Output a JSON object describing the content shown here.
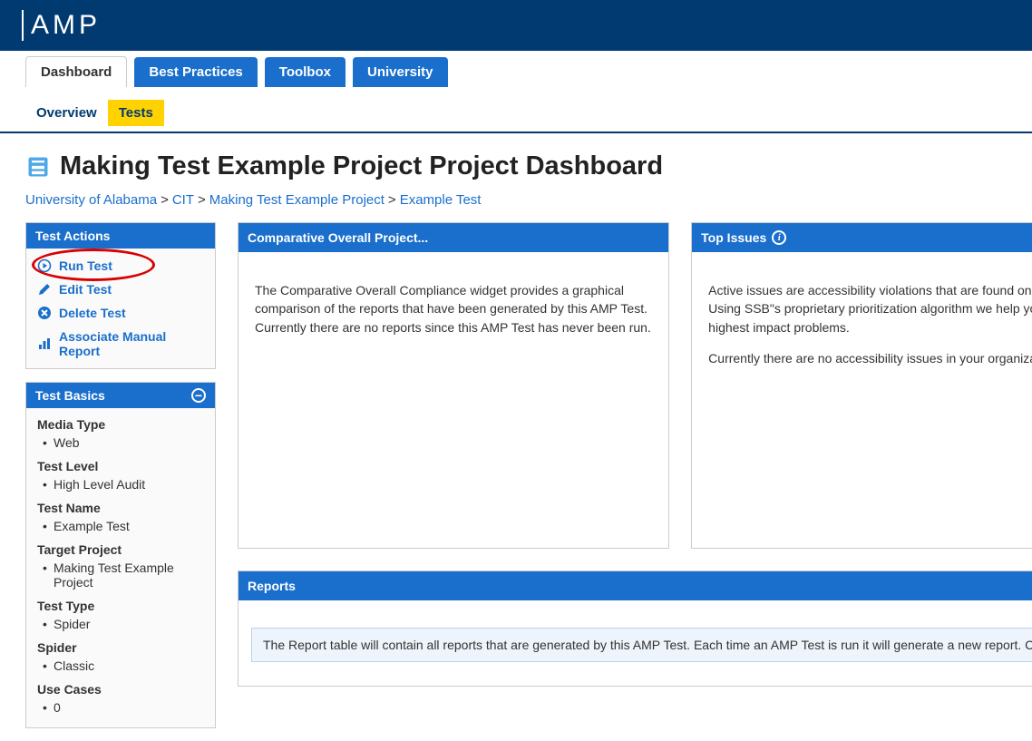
{
  "app_name": "AMP",
  "tabs": [
    {
      "label": "Dashboard",
      "active": true
    },
    {
      "label": "Best Practices",
      "active": false
    },
    {
      "label": "Toolbox",
      "active": false
    },
    {
      "label": "University",
      "active": false
    }
  ],
  "subtabs": [
    {
      "label": "Overview",
      "active": false
    },
    {
      "label": "Tests",
      "active": true
    }
  ],
  "page_title": "Making Test Example Project Project Dashboard",
  "breadcrumb": [
    "University of Alabama",
    "CIT",
    "Making Test Example Project",
    "Example Test"
  ],
  "test_actions": {
    "title": "Test Actions",
    "items": [
      {
        "label": "Run Test",
        "icon": "play-icon",
        "highlight": true
      },
      {
        "label": "Edit Test",
        "icon": "pencil-icon"
      },
      {
        "label": "Delete Test",
        "icon": "delete-icon"
      },
      {
        "label": "Associate Manual Report",
        "icon": "chart-icon"
      }
    ]
  },
  "test_basics": {
    "title": "Test Basics",
    "fields": [
      {
        "label": "Media Type",
        "value": "Web"
      },
      {
        "label": "Test Level",
        "value": "High Level Audit"
      },
      {
        "label": "Test Name",
        "value": "Example Test"
      },
      {
        "label": "Target Project",
        "value": "Making Test Example Project"
      },
      {
        "label": "Test Type",
        "value": "Spider"
      },
      {
        "label": "Spider",
        "value": "Classic"
      },
      {
        "label": "Use Cases",
        "value": "0"
      }
    ]
  },
  "widgets": {
    "comparative": {
      "title": "Comparative Overall Project...",
      "body": "The Comparative Overall Compliance widget provides a graphical comparison of the reports that have been generated by this AMP Test. Currently there are no reports since this AMP Test has never been run."
    },
    "top_issues": {
      "title": "Top Issues",
      "body1": "Active issues are accessibility violations that are found on your site. Using SSB\"s proprietary prioritization algorithm we help you find the highest impact problems.",
      "body2": "Currently there are no accessibility issues in your organization"
    }
  },
  "reports": {
    "title": "Reports",
    "message": "The Report table will contain all reports that are generated by this AMP Test. Each time an AMP Test is run it will generate a new report. Currently the"
  }
}
